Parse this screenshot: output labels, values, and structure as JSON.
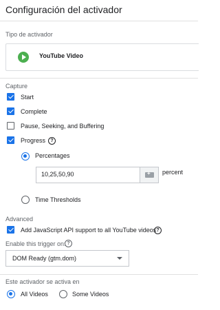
{
  "header": {
    "title": "Configuración del activador"
  },
  "trigger_type": {
    "section_label": "Tipo de activador",
    "name": "YouTube Video",
    "icon": "play-circle-icon",
    "icon_color": "#4caf50"
  },
  "capture": {
    "section_label": "Capture",
    "options": [
      {
        "label": "Start",
        "checked": true
      },
      {
        "label": "Complete",
        "checked": true
      },
      {
        "label": "Pause, Seeking, and Buffering",
        "checked": false
      },
      {
        "label": "Progress",
        "checked": true
      }
    ],
    "progress": {
      "mode_options": [
        {
          "label": "Percentages",
          "selected": true
        },
        {
          "label": "Time Thresholds",
          "selected": false
        }
      ],
      "value": "10,25,50,90",
      "unit": "percent"
    }
  },
  "advanced": {
    "section_label": "Advanced",
    "js_api_label": "Add JavaScript API support to all YouTube videos",
    "js_api_checked": true,
    "enable_label": "Enable this trigger on:",
    "enable_value": "DOM Ready (gtm.dom)"
  },
  "fires_on": {
    "section_label": "Este activador se activa en",
    "options": [
      {
        "label": "All Videos",
        "selected": true
      },
      {
        "label": "Some Videos",
        "selected": false
      }
    ]
  },
  "colors": {
    "accent": "#1a73e8",
    "text": "#202124",
    "muted": "#5f6368"
  }
}
